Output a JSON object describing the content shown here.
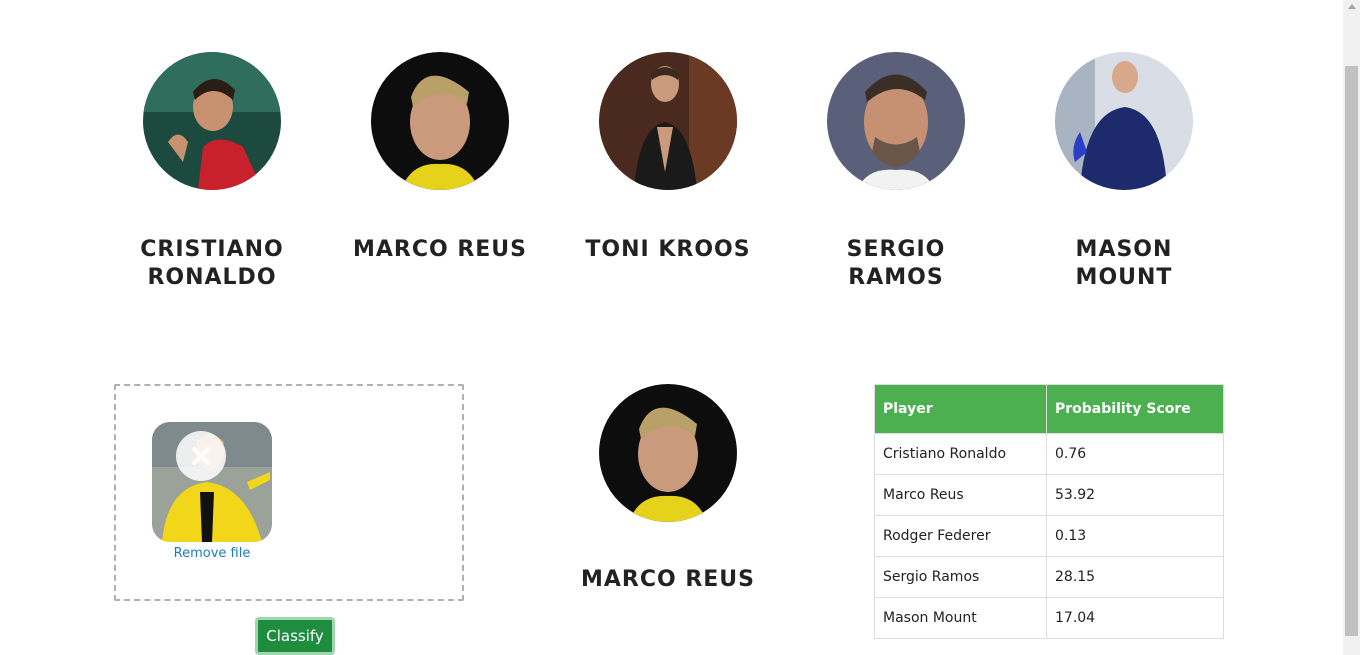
{
  "players": [
    {
      "name": "CRISTIANO RONALDO"
    },
    {
      "name": "MARCO REUS"
    },
    {
      "name": "TONI KROOS"
    },
    {
      "name": "SERGIO RAMOS"
    },
    {
      "name": "MASON MOUNT"
    }
  ],
  "upload": {
    "remove_label": "Remove file"
  },
  "classify_label": "Classify",
  "result": {
    "name": "MARCO REUS"
  },
  "table": {
    "headers": [
      "Player",
      "Probability Score"
    ],
    "rows": [
      [
        "Cristiano Ronaldo",
        "0.76"
      ],
      [
        "Marco Reus",
        "53.92"
      ],
      [
        "Rodger Federer",
        "0.13"
      ],
      [
        "Sergio Ramos",
        "28.15"
      ],
      [
        "Mason Mount",
        "17.04"
      ]
    ]
  },
  "colors": {
    "table_header": "#4caf50",
    "button": "#1e8e3e",
    "link": "#1a7bc4"
  }
}
